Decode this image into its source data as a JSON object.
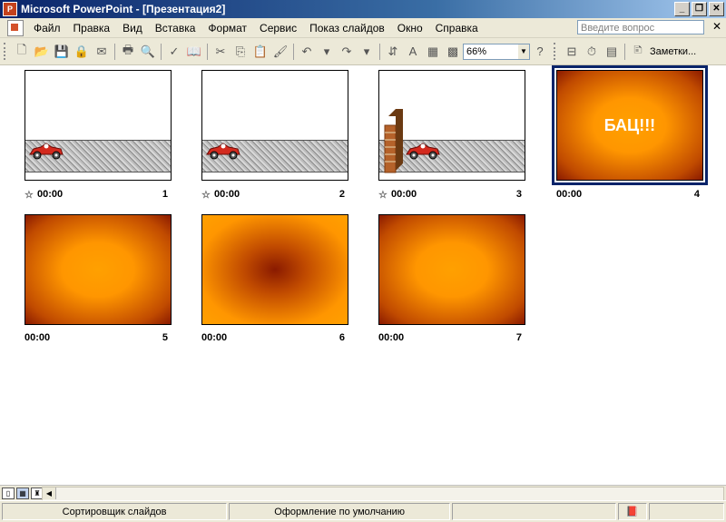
{
  "window": {
    "title": "Microsoft PowerPoint - [Презентация2]"
  },
  "menu": {
    "items": [
      {
        "label": "Файл"
      },
      {
        "label": "Правка"
      },
      {
        "label": "Вид"
      },
      {
        "label": "Вставка"
      },
      {
        "label": "Формат"
      },
      {
        "label": "Сервис"
      },
      {
        "label": "Показ слайдов"
      },
      {
        "label": "Окно"
      },
      {
        "label": "Справка"
      }
    ],
    "ask_placeholder": "Введите вопрос"
  },
  "toolbar": {
    "zoom": "66%",
    "notes_label": "Заметки..."
  },
  "slides": [
    {
      "number": "1",
      "time": "00:00",
      "content": "car",
      "has_transition": true
    },
    {
      "number": "2",
      "time": "00:00",
      "content": "car",
      "has_transition": true
    },
    {
      "number": "3",
      "time": "00:00",
      "content": "car-wall",
      "has_transition": true
    },
    {
      "number": "4",
      "time": "00:00",
      "content": "bang",
      "text": "БАЦ!!!",
      "selected": true
    },
    {
      "number": "5",
      "time": "00:00",
      "content": "orange-dark"
    },
    {
      "number": "6",
      "time": "00:00",
      "content": "orange-light"
    },
    {
      "number": "7",
      "time": "00:00",
      "content": "orange-dark"
    }
  ],
  "statusbar": {
    "view": "Сортировщик слайдов",
    "design": "Оформление по умолчанию"
  },
  "colors": {
    "title_start": "#0a246a",
    "title_end": "#a6caf0",
    "orange": "#ff9600",
    "brown": "#8a1a00"
  }
}
